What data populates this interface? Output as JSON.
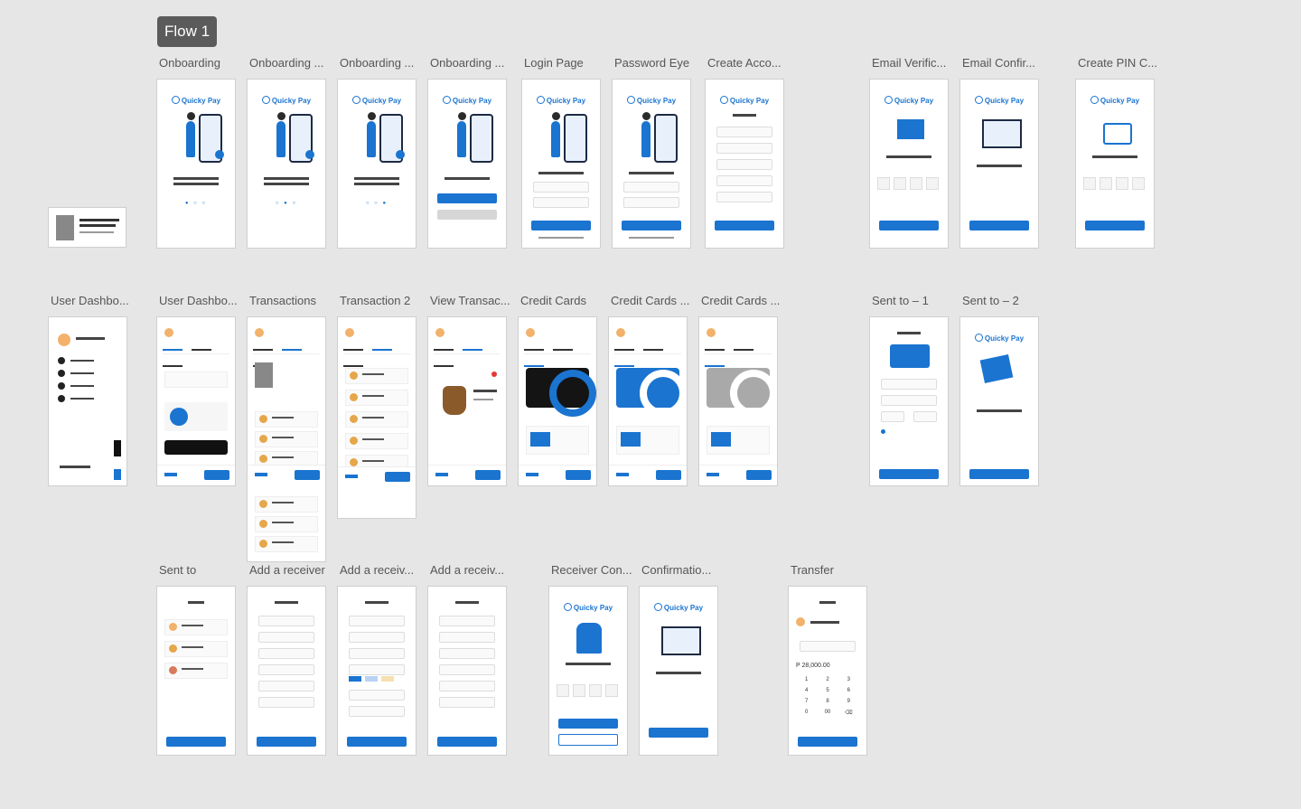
{
  "flow_badge": "Flow 1",
  "brand": "Quicky Pay",
  "labels": {
    "onboarding1": "Onboarding",
    "onboarding2": "Onboarding ...",
    "onboarding3": "Onboarding ...",
    "onboarding4": "Onboarding ...",
    "login": "Login Page",
    "password_eye": "Password Eye",
    "create_account": "Create Acco...",
    "email_verif": "Email Verific...",
    "email_confirm": "Email Confir...",
    "create_pin": "Create PIN C...",
    "user_dash1": "User Dashbo...",
    "user_dash2": "User Dashbo...",
    "transactions": "Transactions",
    "transaction2": "Transaction 2",
    "view_trans": "View Transac...",
    "credit_cards1": "Credit Cards",
    "credit_cards2": "Credit Cards ...",
    "credit_cards3": "Credit Cards ...",
    "sent_to_1": "Sent to – 1",
    "sent_to_2": "Sent to – 2",
    "sent_to": "Sent to",
    "add_receiver1": "Add a receiver",
    "add_receiver2": "Add a receiv...",
    "add_receiver3": "Add a receiv...",
    "receiver_con": "Receiver Con...",
    "confirmation": "Confirmatio...",
    "transfer": "Transfer"
  },
  "transfer": {
    "amount": "P 28,000.00",
    "keys": [
      "1",
      "2",
      "3",
      "4",
      "5",
      "6",
      "7",
      "8",
      "9",
      "0",
      "00",
      "⌫"
    ]
  },
  "colors": {
    "accent": "#1a74d0",
    "canvas": "#e6e6e6"
  }
}
